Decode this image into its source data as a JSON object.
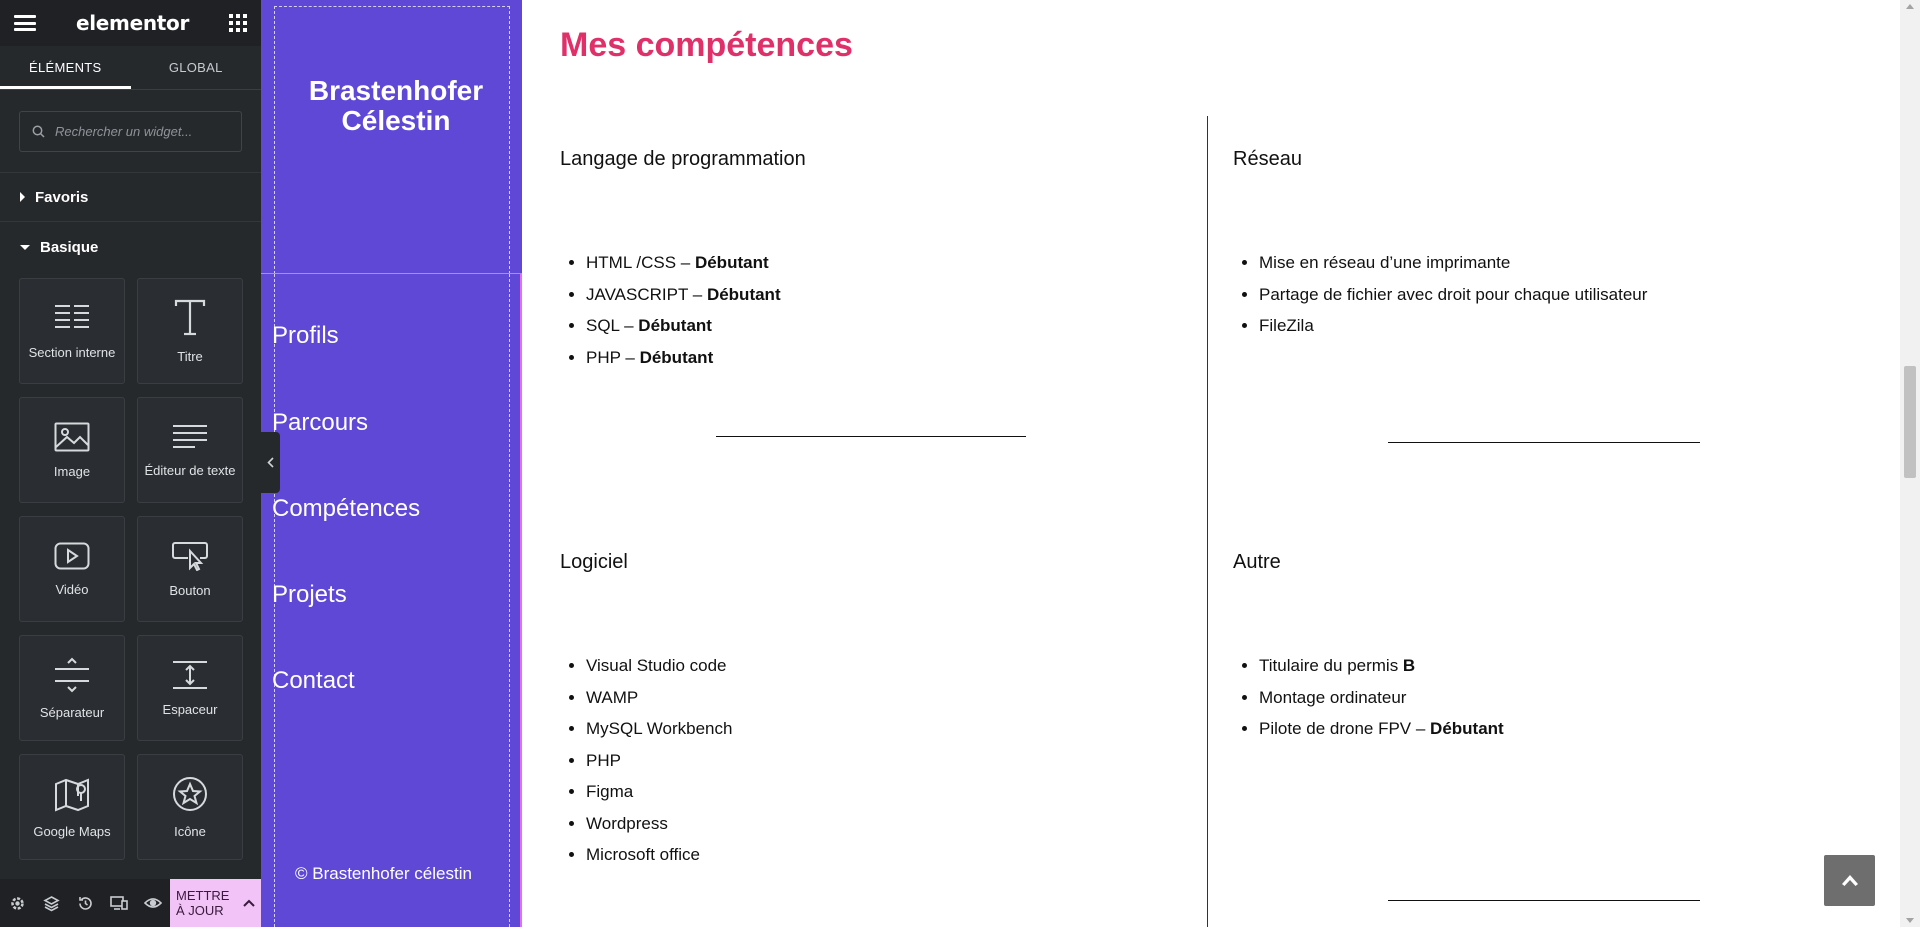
{
  "panel": {
    "logo": "elementor",
    "tabs": [
      {
        "label": "ÉLÉMENTS",
        "active": true
      },
      {
        "label": "GLOBAL",
        "active": false
      }
    ],
    "search_placeholder": "Rechercher un widget...",
    "categories": {
      "favoris": "Favoris",
      "basique": "Basique"
    },
    "widgets": [
      {
        "label": "Section interne",
        "icon": "inner-section-icon"
      },
      {
        "label": "Titre",
        "icon": "heading-icon"
      },
      {
        "label": "Image",
        "icon": "image-icon"
      },
      {
        "label": "Éditeur de texte",
        "icon": "text-editor-icon"
      },
      {
        "label": "Vidéo",
        "icon": "video-icon"
      },
      {
        "label": "Bouton",
        "icon": "button-icon"
      },
      {
        "label": "Séparateur",
        "icon": "divider-icon"
      },
      {
        "label": "Espaceur",
        "icon": "spacer-icon"
      },
      {
        "label": "Google Maps",
        "icon": "google-maps-icon"
      },
      {
        "label": "Icône",
        "icon": "star-icon"
      }
    ],
    "footer": {
      "icons": [
        "settings-icon",
        "navigator-icon",
        "history-icon",
        "responsive-icon",
        "preview-icon"
      ],
      "update_label": "METTRE À JOUR"
    }
  },
  "sidenav": {
    "site_title": "Brastenhofer Célestin",
    "links": [
      "Profils",
      "Parcours",
      "Compétences",
      "Projets",
      "Contact"
    ],
    "copyright": "© Brastenhofer célestin"
  },
  "main": {
    "title": "Mes compétences",
    "sections": {
      "programmation": {
        "title": "Langage de programmation",
        "items": [
          {
            "text": "HTML /CSS – ",
            "bold": "Débutant"
          },
          {
            "text": "JAVASCRIPT – ",
            "bold": "Débutant"
          },
          {
            "text": "SQL – ",
            "bold": "Débutant"
          },
          {
            "text": "PHP – ",
            "bold": "Débutant"
          }
        ]
      },
      "reseau": {
        "title": "Réseau",
        "items": [
          {
            "text": "Mise en réseau d’une imprimante",
            "bold": ""
          },
          {
            "text": "Partage de fichier avec droit pour chaque utilisateur",
            "bold": ""
          },
          {
            "text": "FileZila",
            "bold": ""
          }
        ]
      },
      "logiciel": {
        "title": "Logiciel",
        "items": [
          {
            "text": "Visual Studio code",
            "bold": ""
          },
          {
            "text": "WAMP",
            "bold": ""
          },
          {
            "text": "MySQL Workbench",
            "bold": ""
          },
          {
            "text": "PHP",
            "bold": ""
          },
          {
            "text": "Figma",
            "bold": ""
          },
          {
            "text": "Wordpress",
            "bold": ""
          },
          {
            "text": "Microsoft office",
            "bold": ""
          }
        ]
      },
      "autre": {
        "title": "Autre",
        "items": [
          {
            "text": "Titulaire du permis ",
            "bold": "B"
          },
          {
            "text": "Montage ordinateur",
            "bold": ""
          },
          {
            "text": "Pilote de drone FPV – ",
            "bold": "Débutant"
          }
        ]
      }
    }
  },
  "colors": {
    "panel_bg": "#26292c",
    "nav_bg": "#5f48d6",
    "accent_title": "#e0306a",
    "update_button": "#f1c3f6"
  }
}
